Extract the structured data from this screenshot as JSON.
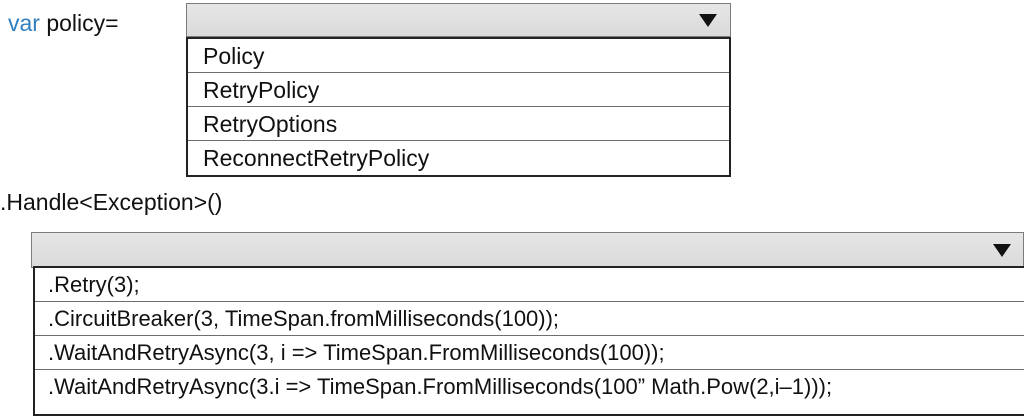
{
  "code": {
    "line1_keyword": "var",
    "line1_text": " policy=",
    "line2_text": ".Handle<Exception>()"
  },
  "dropdown1": {
    "selected": "",
    "arrow_icon": "triangle-down-icon",
    "options": [
      "Policy",
      "RetryPolicy",
      "RetryOptions",
      "ReconnectRetryPolicy"
    ]
  },
  "dropdown2": {
    "selected": "",
    "arrow_icon": "triangle-down-icon",
    "options": [
      ".Retry(3);",
      ".CircuitBreaker(3, TimeSpan.fromMilliseconds(100));",
      ".WaitAndRetryAsync(3, i => TimeSpan.FromMilliseconds(100));",
      ".WaitAndRetryAsync(3.i => TimeSpan.FromMilliseconds(100” Math.Pow(2,i–1)));"
    ]
  },
  "colors": {
    "keyword": "#2f7fc1",
    "dropdown_bg": "#e0e0e0"
  }
}
